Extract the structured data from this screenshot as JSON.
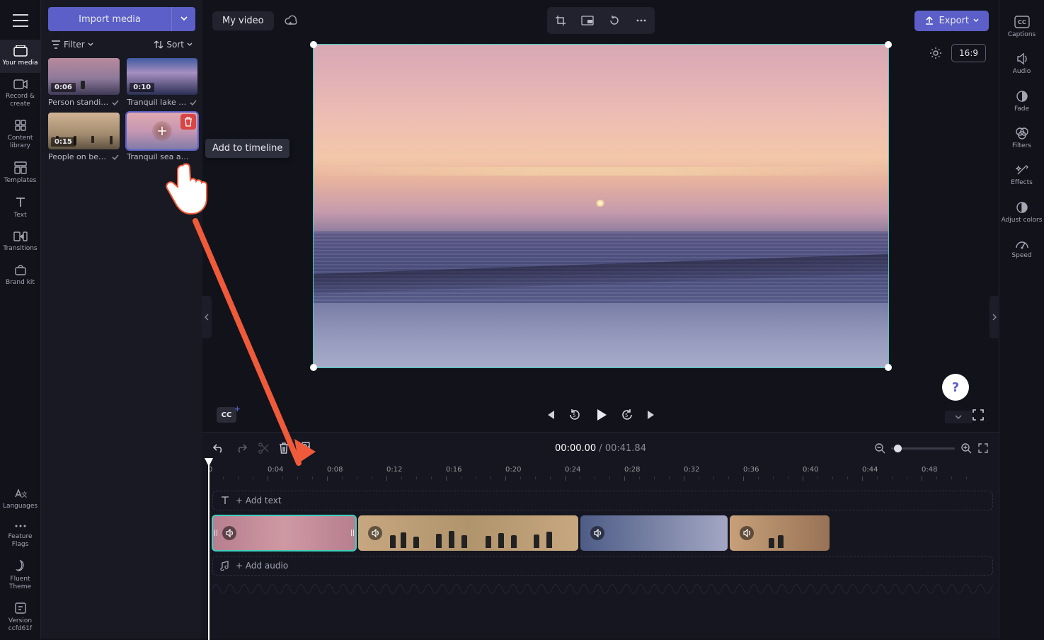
{
  "leftRail": {
    "items": [
      {
        "id": "your-media",
        "label": "Your media"
      },
      {
        "id": "record",
        "label": "Record & create"
      },
      {
        "id": "library",
        "label": "Content library"
      },
      {
        "id": "templates",
        "label": "Templates"
      },
      {
        "id": "text",
        "label": "Text"
      },
      {
        "id": "transitions",
        "label": "Transitions"
      },
      {
        "id": "brand",
        "label": "Brand kit"
      }
    ],
    "bottom": [
      {
        "id": "languages",
        "label": "Languages"
      },
      {
        "id": "flags",
        "label": "Feature Flags"
      },
      {
        "id": "fluent",
        "label": "Fluent Theme"
      },
      {
        "id": "version",
        "label": "Version ccfd61f"
      }
    ]
  },
  "mediaPanel": {
    "import_label": "Import media",
    "filter_label": "Filter",
    "sort_label": "Sort",
    "clips": [
      {
        "dur": "0:06",
        "title": "Person standi…",
        "done": true
      },
      {
        "dur": "0:10",
        "title": "Tranquil lake …",
        "done": true
      },
      {
        "dur": "0:15",
        "title": "People on be…",
        "done": true
      },
      {
        "dur": "",
        "title": "Tranquil sea a…",
        "done": false,
        "selected": true
      }
    ]
  },
  "topbar": {
    "title": "My video",
    "export_label": "Export",
    "aspect": "16:9"
  },
  "preview": {
    "cc_label": "CC"
  },
  "timeline": {
    "current": "00:00.00",
    "total": "00:41.84",
    "ticks": [
      "0",
      "0:04",
      "0:08",
      "0:12",
      "0:16",
      "0:20",
      "0:24",
      "0:28",
      "0:32",
      "0:36",
      "0:40",
      "0:44",
      "0:48"
    ],
    "add_text": "+ Add text",
    "add_audio": "+ Add audio"
  },
  "rightRail": {
    "items": [
      {
        "id": "captions",
        "label": "Captions"
      },
      {
        "id": "audio",
        "label": "Audio"
      },
      {
        "id": "fade",
        "label": "Fade"
      },
      {
        "id": "filters",
        "label": "Filters"
      },
      {
        "id": "effects",
        "label": "Effects"
      },
      {
        "id": "adjust",
        "label": "Adjust colors"
      },
      {
        "id": "speed",
        "label": "Speed"
      }
    ]
  },
  "tooltip": {
    "add_to_timeline": "Add to timeline"
  },
  "help": {
    "label": "?"
  }
}
